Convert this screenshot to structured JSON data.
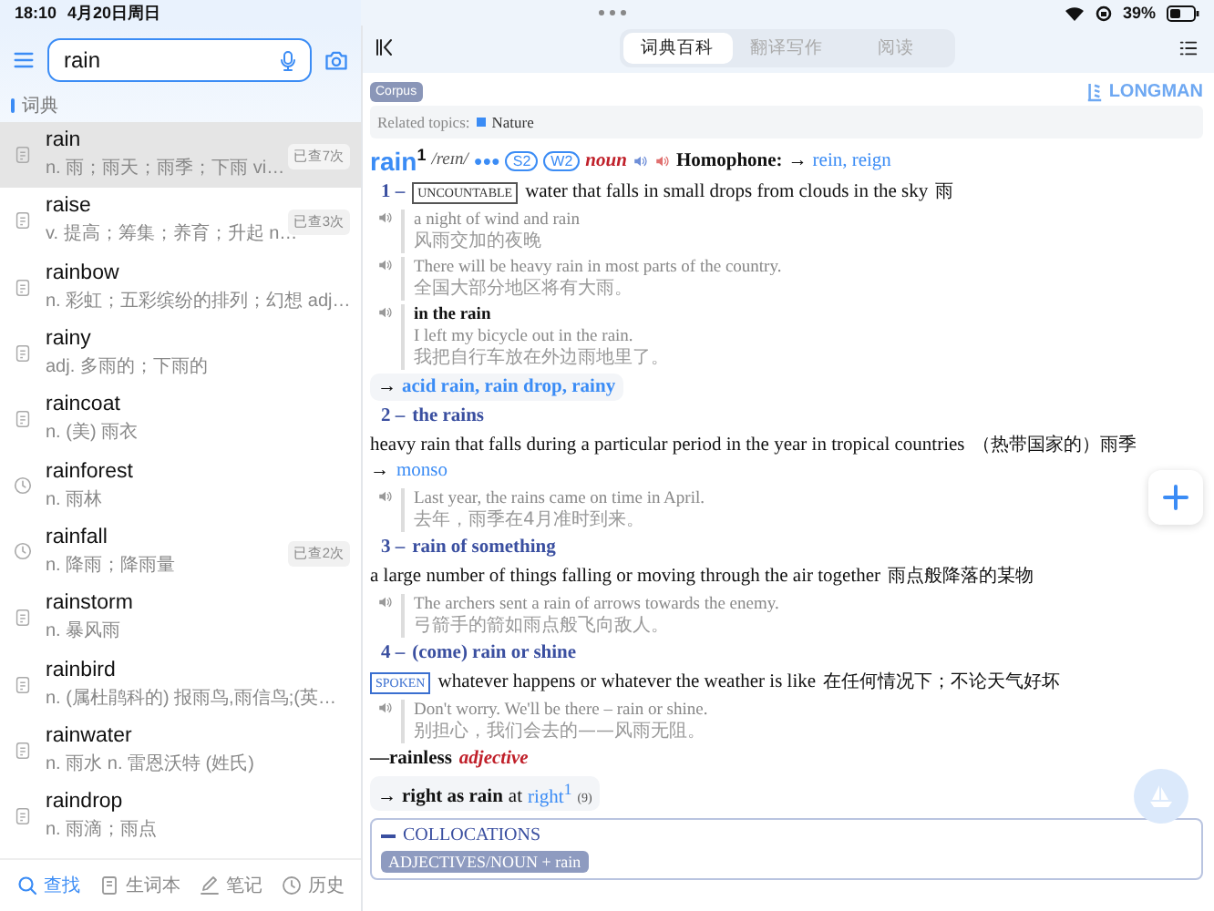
{
  "status_bar": {
    "time": "18:10",
    "date": "4月20日周日",
    "battery": "39%"
  },
  "search": {
    "value": "rain"
  },
  "section_label": "词典",
  "results": [
    {
      "word": "rain",
      "meaning": "n. 雨；雨天；雨季；下雨 vi…",
      "kind": "entry",
      "badge": "已查7次",
      "selected": true
    },
    {
      "word": "raise",
      "meaning": "v. 提高；筹集；养育；升起 n…",
      "kind": "entry",
      "badge": "已查3次",
      "selected": false
    },
    {
      "word": "rainbow",
      "meaning": "n. 彩虹；五彩缤纷的排列；幻想 adj…",
      "kind": "entry",
      "selected": false
    },
    {
      "word": "rainy",
      "meaning": "adj. 多雨的；下雨的",
      "kind": "entry",
      "selected": false
    },
    {
      "word": "raincoat",
      "meaning": "n. (美) 雨衣",
      "kind": "entry",
      "selected": false
    },
    {
      "word": "rainforest",
      "meaning": "n. 雨林",
      "kind": "history",
      "selected": false
    },
    {
      "word": "rainfall",
      "meaning": "n. 降雨；降雨量",
      "kind": "history",
      "badge": "已查2次",
      "selected": false
    },
    {
      "word": "rainstorm",
      "meaning": "n. 暴风雨",
      "kind": "entry",
      "selected": false
    },
    {
      "word": "rainbird",
      "meaning": "n. (属杜鹃科的) 报雨鸟,雨信鸟;(英…",
      "kind": "entry",
      "selected": false
    },
    {
      "word": "rainwater",
      "meaning": "n. 雨水 n. 雷恩沃特 (姓氏)",
      "kind": "entry",
      "selected": false
    },
    {
      "word": "raindrop",
      "meaning": "n. 雨滴；雨点",
      "kind": "entry",
      "selected": false
    }
  ],
  "bottom_tabs": [
    {
      "label": "查找",
      "kind": "search",
      "selected": true
    },
    {
      "label": "生词本",
      "kind": "notebook",
      "selected": false
    },
    {
      "label": "笔记",
      "kind": "pen",
      "selected": false
    },
    {
      "label": "历史",
      "kind": "history",
      "selected": false
    }
  ],
  "tabs": [
    {
      "label": "词典百科",
      "selected": true
    },
    {
      "label": "翻译写作",
      "selected": false
    },
    {
      "label": "阅读",
      "selected": false
    }
  ],
  "entry": {
    "corpus_tag": "Corpus",
    "brand": "LONGMAN",
    "related": {
      "label": "Related topics:",
      "topic": "Nature"
    },
    "headword": "rain",
    "homograph": "1",
    "pronunciation": "/reɪn/",
    "frequency": "●●●",
    "levels": [
      "S2",
      "W2"
    ],
    "pos": "noun",
    "homophone_label": "Homophone:",
    "homophone_arrow": "→",
    "homophones": "rein, reign",
    "senses": [
      {
        "number": "1 –",
        "register": "UNCOUNTABLE",
        "definition": "water that falls in small drops from clouds in the sky",
        "translation": "雨",
        "examples": [
          {
            "en": "a night of wind and rain",
            "zh": "风雨交加的夜晚"
          },
          {
            "en": "There will be heavy rain in most parts of the country.",
            "zh": "全国大部分地区将有大雨。"
          },
          {
            "phrase": "in the rain",
            "en": "I left my bicycle out in the rain.",
            "zh": "我把自行车放在外边雨地里了。"
          }
        ],
        "xref_arrow": "→",
        "xrefs": "acid rain, rain drop, rainy"
      },
      {
        "number": "2 –",
        "signpost": "the rains",
        "definition": "heavy rain that falls during a particular period in the year in tropical countries",
        "translation": "（热带国家的）雨季",
        "see_arrow": "→",
        "see": "monso",
        "examples": [
          {
            "en": "Last year, the rains came on time in April.",
            "zh": "去年，雨季在4月准时到来。"
          }
        ]
      },
      {
        "number": "3 –",
        "signpost": "rain of something",
        "definition": "a large number of things falling or moving through the air together",
        "translation": "雨点般降落的某物",
        "examples": [
          {
            "en": "The archers sent a rain of arrows towards the enemy.",
            "zh": "弓箭手的箭如雨点般飞向敌人。"
          }
        ]
      },
      {
        "number": "4 –",
        "signpost": "(come) rain or shine",
        "register": "SPOKEN",
        "definition": "whatever happens or whatever the weather is like",
        "translation": "在任何情况下；不论天气好坏",
        "examples": [
          {
            "en": "Don't worry. We'll be there – rain or shine.",
            "zh": "别担心，我们会去的——风雨无阻。"
          }
        ]
      }
    ],
    "derived": {
      "word": "—rainless",
      "pos": "adjective"
    },
    "idiom": {
      "arrow": "→",
      "phrase": "right as rain",
      "at": "at",
      "target": "right$^{1}$",
      "sense": "(9)"
    },
    "collocations": {
      "title": "COLLOCATIONS",
      "expanded": true,
      "heading": "ADJECTIVES/NOUN + rain"
    }
  }
}
